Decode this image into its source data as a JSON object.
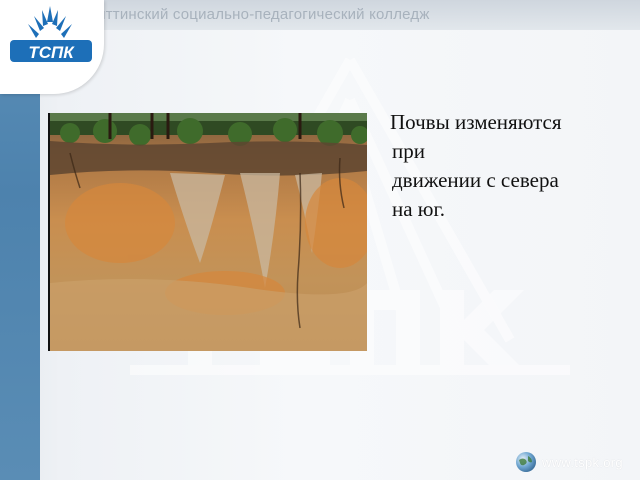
{
  "header": {
    "college_name": "Тольяттинский социально-педагогический колледж",
    "logo_text": "ТСПК"
  },
  "slide": {
    "text_lines": [
      "Почвы изменяются",
      "при",
      "движении с севера",
      "на юг."
    ]
  },
  "footer": {
    "website": "www.tspk.org"
  },
  "colors": {
    "accent_blue": "#4d82ad",
    "logo_blue": "#1d6fb8"
  },
  "icons": [
    "college-logo-icon",
    "globe-icon"
  ]
}
